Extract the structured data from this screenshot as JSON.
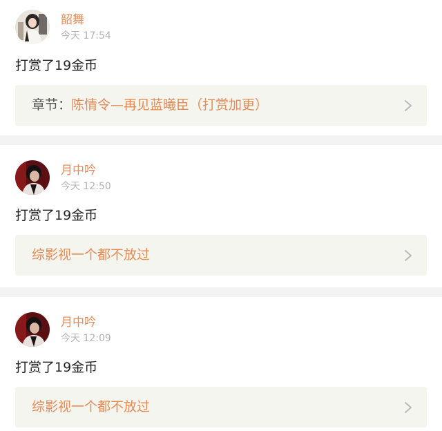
{
  "feed": {
    "items": [
      {
        "user_name": "韶舞",
        "time": "今天 17:54",
        "avatar": "avatar-woman-white-dress",
        "message": "打赏了19金币",
        "link_prefix": "章节：",
        "link_title": "陈情令—再见蓝曦臣（打赏加更）"
      },
      {
        "user_name": "月中吟",
        "time": "今天 12:50",
        "avatar": "avatar-man-dark",
        "message": "打赏了19金币",
        "link_prefix": "",
        "link_title": "综影视一个都不放过"
      },
      {
        "user_name": "月中吟",
        "time": "今天 12:09",
        "avatar": "avatar-man-dark",
        "message": "打赏了19金币",
        "link_prefix": "",
        "link_title": "综影视一个都不放过"
      }
    ]
  },
  "colors": {
    "accent": "#e48b55",
    "text": "#222222",
    "muted": "#b3b3b3",
    "link_background": "#f5f5ef",
    "separator": "#f3f3f3"
  }
}
